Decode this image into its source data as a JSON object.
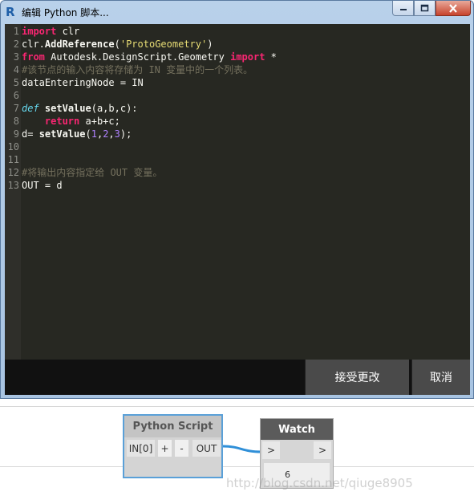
{
  "window": {
    "title": "编辑 Python 脚本...",
    "app_icon_letter": "R"
  },
  "editor": {
    "lines": [
      {
        "n": "1",
        "segments": [
          {
            "t": "import",
            "c": "kw"
          },
          {
            "t": " clr",
            "c": ""
          }
        ]
      },
      {
        "n": "2",
        "segments": [
          {
            "t": "clr.",
            "c": ""
          },
          {
            "t": "AddReference",
            "c": "fn"
          },
          {
            "t": "(",
            "c": ""
          },
          {
            "t": "'ProtoGeometry'",
            "c": "str"
          },
          {
            "t": ")",
            "c": ""
          }
        ]
      },
      {
        "n": "3",
        "segments": [
          {
            "t": "from",
            "c": "kw"
          },
          {
            "t": " Autodesk.DesignScript.Geometry ",
            "c": ""
          },
          {
            "t": "import",
            "c": "kw"
          },
          {
            "t": " *",
            "c": ""
          }
        ]
      },
      {
        "n": "4",
        "segments": [
          {
            "t": "#该节点的输入内容将存储为 IN 变量中的一个列表。",
            "c": "cm"
          }
        ]
      },
      {
        "n": "5",
        "segments": [
          {
            "t": "dataEnteringNode = IN",
            "c": ""
          }
        ]
      },
      {
        "n": "6",
        "segments": []
      },
      {
        "n": "7",
        "segments": [
          {
            "t": "def",
            "c": "def"
          },
          {
            "t": " ",
            "c": ""
          },
          {
            "t": "setValue",
            "c": "fn"
          },
          {
            "t": "(a,b,c):",
            "c": ""
          }
        ]
      },
      {
        "n": "8",
        "segments": [
          {
            "t": "    ",
            "c": ""
          },
          {
            "t": "return",
            "c": "kw"
          },
          {
            "t": " a+b+c;",
            "c": ""
          }
        ]
      },
      {
        "n": "9",
        "segments": [
          {
            "t": "d= ",
            "c": ""
          },
          {
            "t": "setValue",
            "c": "fn"
          },
          {
            "t": "(",
            "c": ""
          },
          {
            "t": "1",
            "c": "num"
          },
          {
            "t": ",",
            "c": ""
          },
          {
            "t": "2",
            "c": "num"
          },
          {
            "t": ",",
            "c": ""
          },
          {
            "t": "3",
            "c": "num"
          },
          {
            "t": ");",
            "c": ""
          }
        ]
      },
      {
        "n": "10",
        "segments": []
      },
      {
        "n": "11",
        "segments": []
      },
      {
        "n": "12",
        "segments": [
          {
            "t": "#将输出内容指定给 OUT 变量。",
            "c": "cm"
          }
        ]
      },
      {
        "n": "13",
        "segments": [
          {
            "t": "OUT = d",
            "c": ""
          }
        ]
      }
    ]
  },
  "buttons": {
    "accept_label": "接受更改",
    "cancel_label": "取消"
  },
  "canvas": {
    "python_node": {
      "title": "Python Script",
      "in_port": "IN[0]",
      "add_label": "+",
      "remove_label": "-",
      "out_port": "OUT"
    },
    "watch_node": {
      "title": "Watch",
      "in_port": ">",
      "out_port": ">",
      "value": "6"
    },
    "watermark": "http://blog.csdn.net/qiuge8905"
  },
  "colors": {
    "editor_bg": "#272822",
    "keyword": "#f92672",
    "string": "#e6db74",
    "comment": "#75715e",
    "number": "#ae81ff",
    "wire": "#2f8fd8"
  }
}
